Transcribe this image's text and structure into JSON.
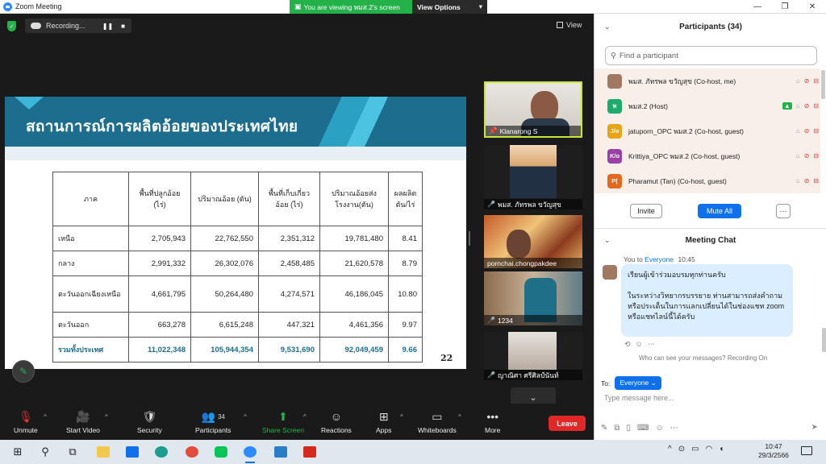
{
  "window": {
    "title": "Zoom Meeting",
    "share_banner": "You are viewing พมส.2's screen",
    "view_options": "View Options",
    "controls": [
      "—",
      "❐",
      "✕"
    ]
  },
  "meeting": {
    "recording_label": "Recording...",
    "view_label": "View"
  },
  "slide": {
    "title": "สถานการณ์การผลิตอ้อยของประเทศไทย",
    "page_number": "22",
    "headers": [
      "ภาค",
      "พื้นที่ปลูกอ้อย (ไร่)",
      "ปริมาณอ้อย (ตัน)",
      "พื้นที่เก็บเกี่ยวอ้อย (ไร่)",
      "ปริมาณอ้อยส่ง โรงงาน(ตัน)",
      "ผลผลิต ตัน/ไร่"
    ],
    "rows": [
      [
        "เหนือ",
        "2,705,943",
        "22,762,550",
        "2,351,312",
        "19,781,480",
        "8.41"
      ],
      [
        "กลาง",
        "2,991,332",
        "26,302,076",
        "2,458,485",
        "21,620,578",
        "8.79"
      ],
      [
        "ตะวันออกเฉียงเหนือ",
        "4,661,795",
        "50,264,480",
        "4,274,571",
        "46,186,045",
        "10.80"
      ],
      [
        "ตะวันออก",
        "663,278",
        "6,615,248",
        "447,321",
        "4,461,356",
        "9.97"
      ]
    ],
    "total": [
      "รวมทั้งประเทศ",
      "11,022,348",
      "105,944,354",
      "9,531,690",
      "92,049,459",
      "9.66"
    ]
  },
  "videos": [
    {
      "name": "Klanarong S"
    },
    {
      "name": "พมส. ภัทรพล ขวัญสุข"
    },
    {
      "name": "pornchai.chongpakdee"
    },
    {
      "name": "1234"
    },
    {
      "name": "ญาณิศา ศรีศิลป์นันท์"
    }
  ],
  "toolbar": {
    "unmute": "Unmute",
    "start_video": "Start Video",
    "security": "Security",
    "participants": "Participants",
    "participants_count": "34",
    "share_screen": "Share Screen",
    "reactions": "Reactions",
    "apps": "Apps",
    "whiteboards": "Whiteboards",
    "more": "More",
    "leave": "Leave"
  },
  "participants_panel": {
    "title": "Participants (34)",
    "search_placeholder": "Find a participant",
    "list": [
      {
        "initials": "",
        "name": "พมส. ภัทรพล ขวัญสุข (Co-host, me)",
        "color": "#a17860"
      },
      {
        "initials": "พ",
        "name": "พมส.2 (Host)",
        "color": "#1faa6e"
      },
      {
        "initials": "J/o",
        "name": "jatuporn_OPC พมส.2 (Co-host, guest)",
        "color": "#e8a317"
      },
      {
        "initials": "K/o",
        "name": "Krittiya_OPC พมส.2 (Co-host, guest)",
        "color": "#9b3fa6"
      },
      {
        "initials": "P(",
        "name": "Pharamut (Tan) (Co-host, guest)",
        "color": "#e2691f"
      }
    ],
    "invite": "Invite",
    "mute_all": "Mute All",
    "more": "···"
  },
  "chat": {
    "title": "Meeting Chat",
    "sender": "You to ",
    "recipient": "Everyone",
    "time": "10:45",
    "message_line1": "เรียนผู้เข้าร่วมอบรมทุกท่านครับ",
    "message_line2": "ในระหว่างวิทยากรบรรยาย ท่านสามารถส่งคำถามหรือประเด็นในการแลกเปลี่ยนได้ในช่องแชท zoom หรือแชทไลน์นี้ได้ครับ",
    "who_can_see": "Who can see your messages? Recording On",
    "to_label": "To:",
    "to_value": "Everyone",
    "input_placeholder": "Type message here..."
  },
  "taskbar": {
    "time": "10:47",
    "date": "29/3/2566"
  },
  "colors": {
    "zoom_blue": "#0e71eb",
    "share_green": "#24b14a",
    "leave_red": "#e02828",
    "slide_header": "#1d6e8e"
  }
}
